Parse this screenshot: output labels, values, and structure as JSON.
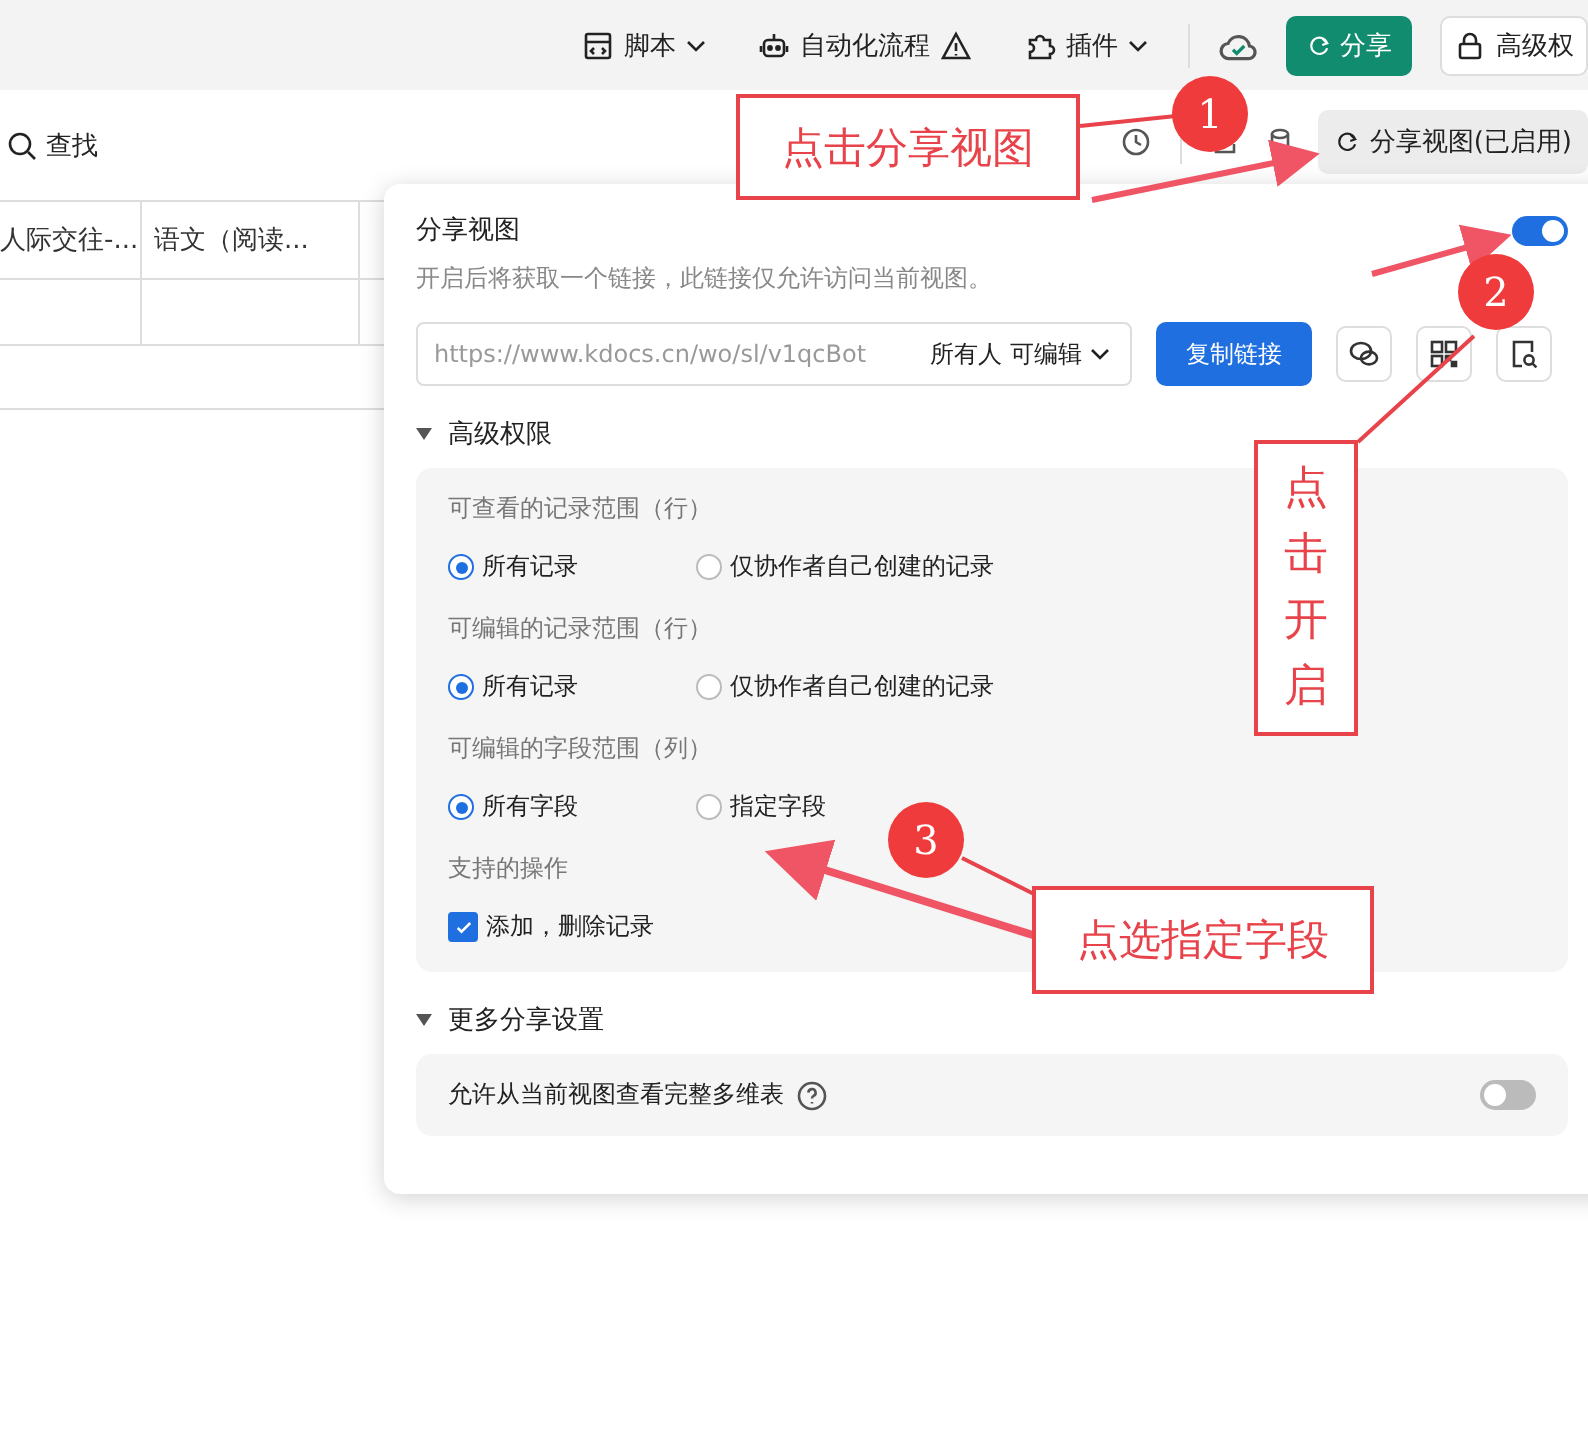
{
  "top_toolbar": {
    "items": [
      {
        "kind": "script",
        "label": "脚本",
        "caret": true
      },
      {
        "kind": "automation",
        "label": "自动化流程",
        "caret": false
      },
      {
        "kind": "plugin",
        "label": "插件",
        "caret": true
      }
    ],
    "share_button": "分享",
    "permissions_button": "高级权"
  },
  "view_toolbar": {
    "search": "查找",
    "share_view_button": "分享视图(已启用)"
  },
  "table": {
    "columns": [
      "人际交往-...",
      "语文（阅读..."
    ]
  },
  "share_panel": {
    "title": "分享视图",
    "enabled": true,
    "description": "开启后将获取一个链接，此链接仅允许访问当前视图。",
    "link": {
      "url": "https://www.kdocs.cn/wo/sl/v1qcBot",
      "permission": "所有人 可编辑",
      "copy_button": "复制链接"
    },
    "advanced": {
      "title": "高级权限",
      "expanded": true,
      "groups": [
        {
          "kind": "radio",
          "label": "可查看的记录范围（行）",
          "options": [
            {
              "label": "所有记录",
              "selected": true
            },
            {
              "label": "仅协作者自己创建的记录",
              "selected": false
            }
          ]
        },
        {
          "kind": "radio",
          "label": "可编辑的记录范围（行）",
          "options": [
            {
              "label": "所有记录",
              "selected": true
            },
            {
              "label": "仅协作者自己创建的记录",
              "selected": false
            }
          ]
        },
        {
          "kind": "radio",
          "label": "可编辑的字段范围（列）",
          "options": [
            {
              "label": "所有字段",
              "selected": true
            },
            {
              "label": "指定字段",
              "selected": false
            }
          ]
        },
        {
          "kind": "checkbox",
          "label": "支持的操作",
          "options": [
            {
              "label": "添加，删除记录",
              "checked": true
            }
          ]
        }
      ]
    },
    "more": {
      "title": "更多分享设置",
      "expanded": true,
      "settings": [
        {
          "label": "允许从当前视图查看完整多维表",
          "on": false
        }
      ]
    }
  },
  "annotations": [
    {
      "number": "1",
      "text": "点击分享视图"
    },
    {
      "number": "2",
      "text": "点击开启"
    },
    {
      "number": "3",
      "text": "点选指定字段"
    }
  ]
}
